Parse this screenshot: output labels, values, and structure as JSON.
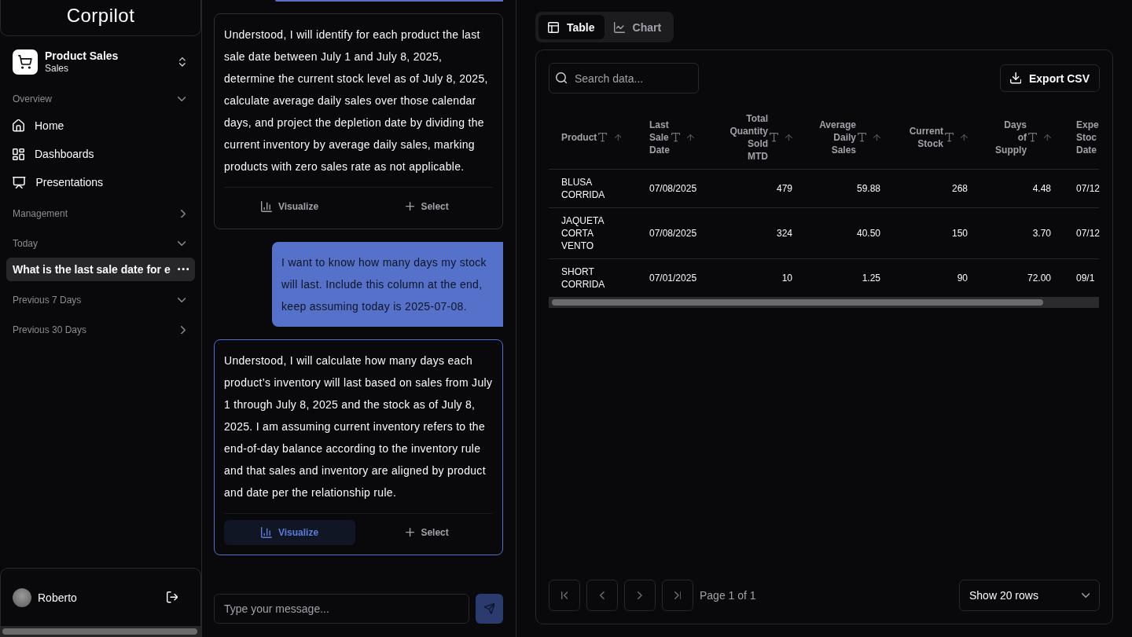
{
  "sidebar": {
    "logo": "Corpilot",
    "workspace": {
      "name": "Product Sales",
      "subtitle": "Sales"
    },
    "sections": [
      {
        "label": "Overview",
        "kind": "nav",
        "expanded": true,
        "items": [
          {
            "label": "Home",
            "selected": false
          },
          {
            "label": "Dashboards",
            "selected": false
          },
          {
            "label": "Presentations",
            "selected": false
          }
        ]
      },
      {
        "label": "Management",
        "expanded": false
      },
      {
        "label": "Today",
        "kind": "history",
        "expanded": true,
        "items": [
          {
            "label": "What is the last sale date for e",
            "selected": true
          }
        ]
      },
      {
        "label": "Previous 7 Days",
        "expanded": true
      },
      {
        "label": "Previous 30 Days",
        "expanded": false
      }
    ],
    "user": {
      "name": "Roberto"
    }
  },
  "chat": {
    "messages": [
      {
        "kind": "assistant",
        "selected": false,
        "text": "Understood, I will identify for each product the last sale date between July 1 and July 8, 2025, determine the current stock level as of July 8, 2025, calculate average daily sales over those calendar days, and project the depletion date by dividing the current inventory by average daily sales, marking products with zero sales rate as not applicable.",
        "actions": [
          {
            "label": "Visualize",
            "active": false
          },
          {
            "label": "Select",
            "active": false
          }
        ]
      },
      {
        "kind": "user",
        "selected": false,
        "text": "I want to know how many days my stock will last. Include this column at the end, keep assuming today is 2025-07-08."
      },
      {
        "kind": "assistant",
        "selected": true,
        "text": "Understood, I will calculate how many days each product’s inventory will last based on sales from July 1 through July 8, 2025 and the stock as of July 8, 2025. I am assuming current inventory refers to the end-of-day balance according to the inventory rule and that sales and inventory are aligned by product and date per the relationship rule.",
        "actions": [
          {
            "label": "Visualize",
            "active": true
          },
          {
            "label": "Select",
            "active": false
          }
        ]
      }
    ],
    "composer": {
      "placeholder": "Type your message..."
    }
  },
  "data_view": {
    "tabs": [
      {
        "label": "Table",
        "selected": true
      },
      {
        "label": "Chart",
        "selected": false
      }
    ],
    "search": {
      "placeholder": "Search data..."
    },
    "export_button": "Export CSV",
    "table": {
      "columns": [
        {
          "label": "Product",
          "kind": "text"
        },
        {
          "label": "Last Sale Date",
          "kind": "date"
        },
        {
          "label": "Total Quantity Sold MTD",
          "kind": "number"
        },
        {
          "label": "Average Daily Sales",
          "kind": "number"
        },
        {
          "label": "Current Stock",
          "kind": "number"
        },
        {
          "label": "Days of Supply",
          "kind": "number"
        },
        {
          "label": "Expe Stoc Date",
          "kind": "date"
        }
      ],
      "rows": [
        [
          "BLUSA CORRIDA",
          "07/08/2025",
          "479",
          "59.88",
          "268",
          "4.48",
          "07/12"
        ],
        [
          "JAQUETA CORTA VENTO",
          "07/08/2025",
          "324",
          "40.50",
          "150",
          "3.70",
          "07/12"
        ],
        [
          "SHORT CORRIDA",
          "07/01/2025",
          "10",
          "1.25",
          "90",
          "72.00",
          "09/1"
        ]
      ]
    },
    "pagination": {
      "buttons": [
        {
          "disabled": true
        },
        {
          "disabled": true
        },
        {
          "disabled": true
        },
        {
          "disabled": true
        }
      ],
      "page_label": "Page 1 of 1",
      "rows_select": "Show 20 rows"
    }
  }
}
